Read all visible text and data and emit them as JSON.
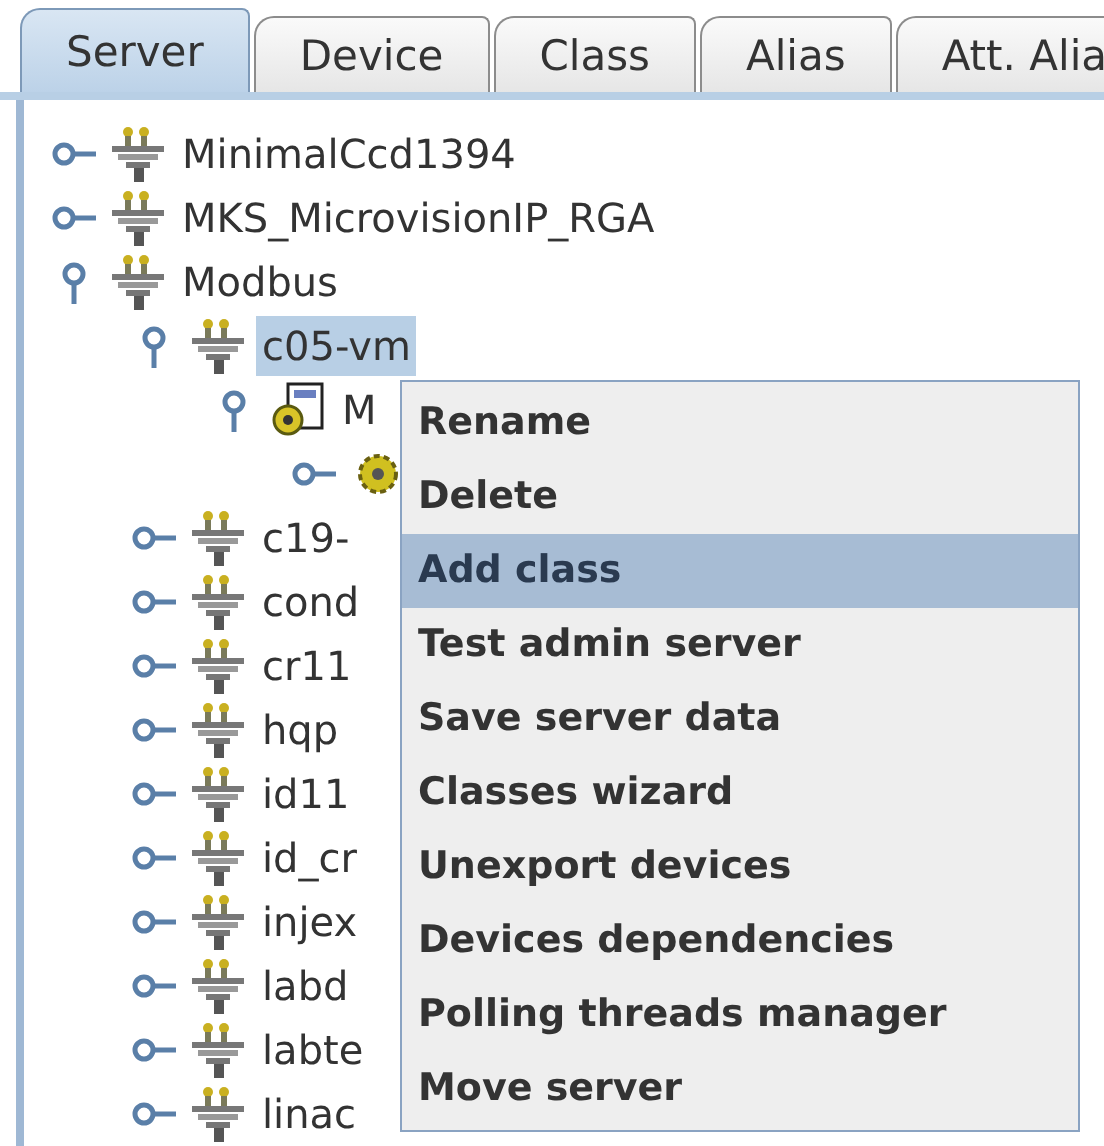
{
  "tabs": [
    {
      "label": "Server",
      "selected": true
    },
    {
      "label": "Device",
      "selected": false
    },
    {
      "label": "Class",
      "selected": false
    },
    {
      "label": "Alias",
      "selected": false
    },
    {
      "label": "Att. Alia",
      "selected": false
    }
  ],
  "tree": [
    {
      "label": "MinimalCcd1394",
      "kind": "server",
      "expanded": false,
      "selected": false
    },
    {
      "label": "MKS_MicrovisionIP_RGA",
      "kind": "server",
      "expanded": false,
      "selected": false
    },
    {
      "label": "Modbus",
      "kind": "server",
      "expanded": true,
      "selected": false,
      "children": [
        {
          "label": "c05-vm",
          "kind": "server",
          "expanded": true,
          "selected": true,
          "children": [
            {
              "label": "M",
              "kind": "class",
              "expanded": true,
              "selected": false,
              "children": [
                {
                  "kind": "device",
                  "expanded": false
                }
              ]
            }
          ]
        },
        {
          "label": "c19-",
          "kind": "server",
          "expanded": false,
          "selected": false
        },
        {
          "label": "cond",
          "kind": "server",
          "expanded": false,
          "selected": false
        },
        {
          "label": "cr11",
          "kind": "server",
          "expanded": false,
          "selected": false
        },
        {
          "label": "hqp",
          "kind": "server",
          "expanded": false,
          "selected": false
        },
        {
          "label": "id11",
          "kind": "server",
          "expanded": false,
          "selected": false
        },
        {
          "label": "id_cr",
          "kind": "server",
          "expanded": false,
          "selected": false
        },
        {
          "label": "injex",
          "kind": "server",
          "expanded": false,
          "selected": false
        },
        {
          "label": "labd",
          "kind": "server",
          "expanded": false,
          "selected": false
        },
        {
          "label": "labte",
          "kind": "server",
          "expanded": false,
          "selected": false
        },
        {
          "label": "linac",
          "kind": "server",
          "expanded": false,
          "selected": false
        }
      ]
    }
  ],
  "context_menu": [
    {
      "label": "Rename",
      "selected": false
    },
    {
      "label": "Delete",
      "selected": false
    },
    {
      "label": "Add class",
      "selected": true
    },
    {
      "label": "Test admin server",
      "selected": false
    },
    {
      "label": "Save server data",
      "selected": false
    },
    {
      "label": "Classes wizard",
      "selected": false
    },
    {
      "label": "Unexport devices",
      "selected": false
    },
    {
      "label": "Devices dependencies",
      "selected": false
    },
    {
      "label": "Polling threads manager",
      "selected": false
    },
    {
      "label": "Move server",
      "selected": false
    }
  ]
}
